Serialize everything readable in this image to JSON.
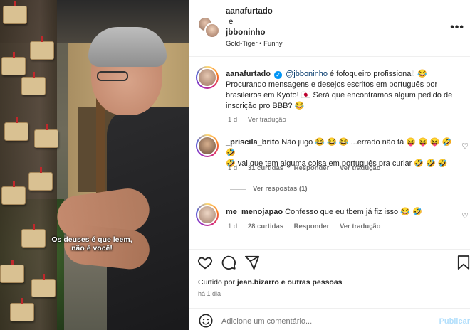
{
  "video": {
    "caption_line1": "Os deuses é que leem,",
    "caption_line2": "não é você!"
  },
  "header": {
    "user1": "aanafurtado",
    "and": "e",
    "user2": "jbboninho",
    "audio": "Gold-Tiger • Funny",
    "more": "•••"
  },
  "comments": [
    {
      "user": "aanafurtado",
      "mention": "@jbboninho",
      "text_line1": "é fofoqueiro profissional! 😂",
      "text_line2": "Procurando mensagens e desejos escritos em português por",
      "text_line3": "brasileiros em Kyoto! 🇯🇵 Será que encontramos algum pedido de",
      "text_line4": "inscrição pro BBB? 😂",
      "time": "1 d",
      "translate": "Ver tradução"
    },
    {
      "user": "_priscila_brito",
      "text_line1": "Não jugo 😂 😂 😂 ...errado não tá 😝 😝 😝 🤣 🤣",
      "text_line2": "🤣 vai que tem alguma coisa em português pra curiar 🤣 🤣 🤣",
      "time": "1 d",
      "likes": "31 curtidas",
      "reply": "Responder",
      "translate": "Ver tradução",
      "view_replies": "Ver respostas (1)"
    },
    {
      "user": "me_menojapao",
      "text_line1": "Confesso que eu tbem já fiz isso 😂 🤣",
      "time": "1 d",
      "likes": "28 curtidas",
      "reply": "Responder",
      "translate": "Ver tradução"
    }
  ],
  "liked_by": {
    "prefix": "Curtido por",
    "user": "jean.bizarro",
    "suffix": "e outras pessoas"
  },
  "posted": "há 1 dia",
  "add_comment": {
    "placeholder": "Adicione um comentário...",
    "publish": "Publicar"
  },
  "icons": [
    "heart-icon",
    "comment-icon",
    "share-icon",
    "bookmark-icon",
    "emoji-icon",
    "verified-icon"
  ]
}
